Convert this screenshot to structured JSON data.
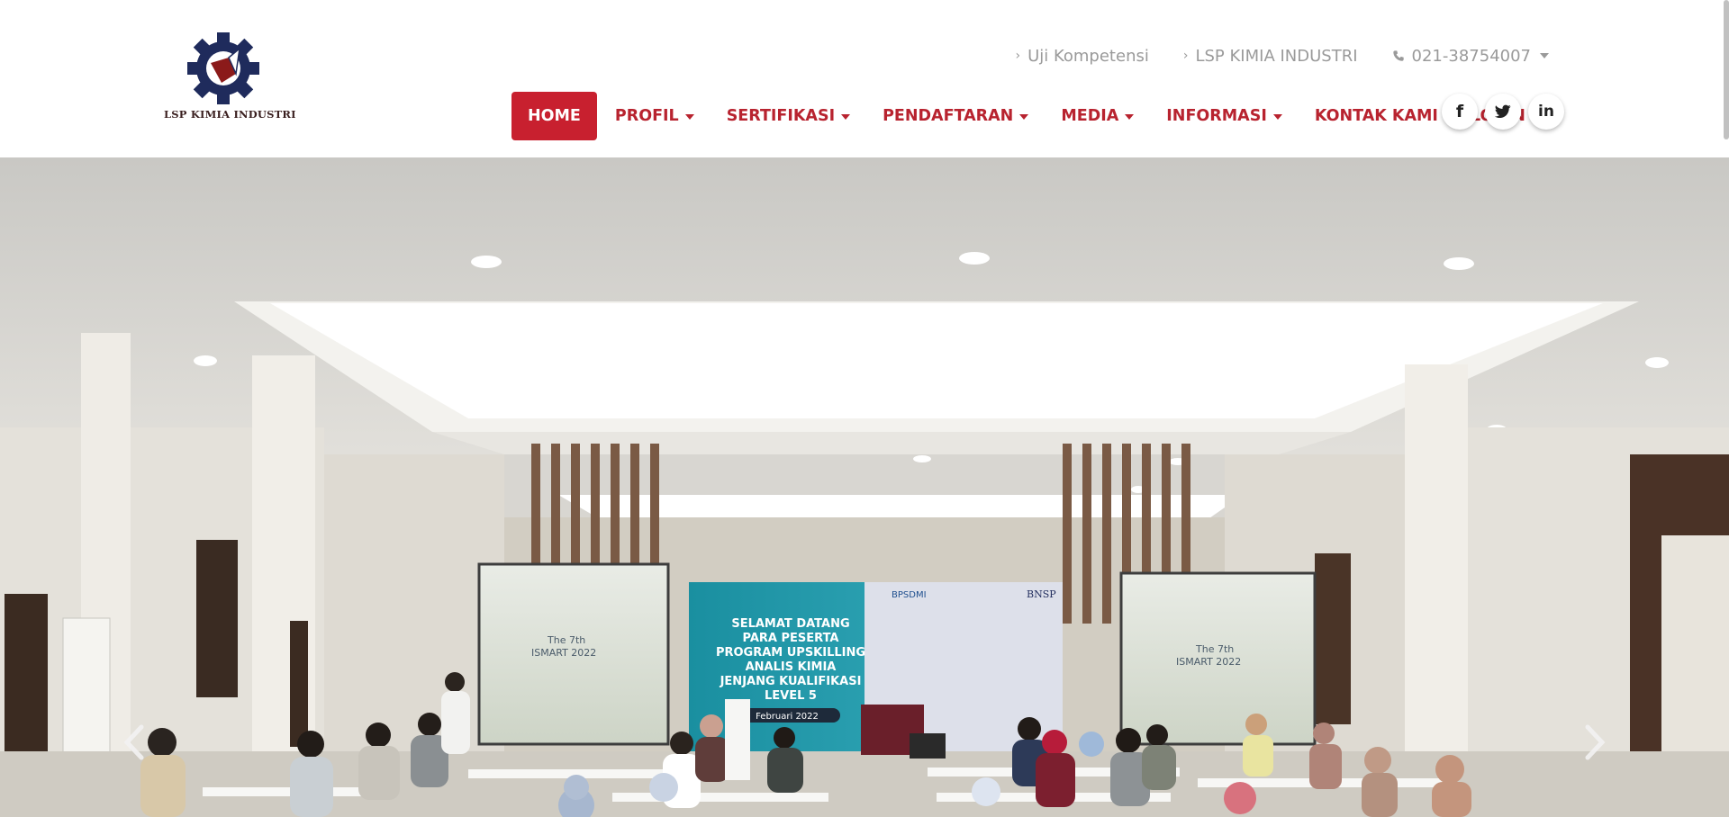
{
  "brand": {
    "name": "LSP KIMIA INDUSTRI",
    "logo_icon": "gear-logo-icon",
    "colors": {
      "primary": "#c8202f",
      "navy": "#1f2b5c",
      "maroon": "#8b1a1a"
    }
  },
  "topbar": {
    "links": [
      {
        "label": "Uji Kompetensi",
        "icon": "chevron-right-icon"
      },
      {
        "label": "LSP KIMIA INDUSTRI",
        "icon": "chevron-right-icon"
      }
    ],
    "phone": {
      "label": "021-38754007",
      "icon": "phone-icon"
    }
  },
  "nav": {
    "items": [
      {
        "label": "HOME",
        "active": true,
        "dropdown": false
      },
      {
        "label": "PROFIL",
        "dropdown": true
      },
      {
        "label": "SERTIFIKASI",
        "dropdown": true
      },
      {
        "label": "PENDAFTARAN",
        "dropdown": true
      },
      {
        "label": "MEDIA",
        "dropdown": true
      },
      {
        "label": "INFORMASI",
        "dropdown": true
      },
      {
        "label": "KONTAK KAMI",
        "dropdown": false
      },
      {
        "label": "LOGIN",
        "dropdown": false
      }
    ]
  },
  "social": [
    {
      "icon": "facebook-icon",
      "label": "f"
    },
    {
      "icon": "twitter-icon"
    },
    {
      "icon": "linkedin-icon",
      "label": "in"
    }
  ],
  "hero": {
    "banner_lines": [
      "SELAMAT DATANG",
      "PARA PESERTA",
      "PROGRAM UPSKILLING",
      "ANALIS KIMIA",
      "JENJANG KUALIFIKASI",
      "LEVEL 5"
    ],
    "banner_date": "Februari 2022",
    "banner_logos": [
      "BPSDMI",
      "BNSP"
    ],
    "screen_text": [
      "The 7th",
      "ISMART 2022"
    ],
    "prev_icon": "chevron-left-icon",
    "next_icon": "chevron-right-icon"
  }
}
